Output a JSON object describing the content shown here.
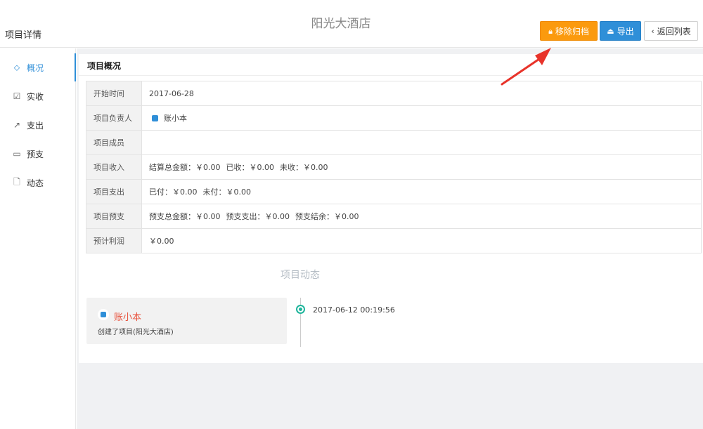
{
  "header": {
    "page_label": "项目详情",
    "hotel_title": "阳光大酒店",
    "buttons": {
      "archive": "移除归档",
      "export": "导出",
      "back": "返回列表"
    }
  },
  "sidebar": {
    "items": [
      {
        "label": "概况",
        "icon": "layers-icon",
        "active": true
      },
      {
        "label": "实收",
        "icon": "checkbox-icon",
        "active": false
      },
      {
        "label": "支出",
        "icon": "external-link-icon",
        "active": false
      },
      {
        "label": "预支",
        "icon": "folder-icon",
        "active": false
      },
      {
        "label": "动态",
        "icon": "file-icon",
        "active": false
      }
    ]
  },
  "overview": {
    "title": "项目概况",
    "rows": {
      "start_date": {
        "key": "开始时间",
        "value": "2017-06-28"
      },
      "owner": {
        "key": "项目负责人",
        "value": "账小本"
      },
      "members": {
        "key": "项目成员",
        "value": ""
      },
      "income": {
        "key": "项目收入",
        "settled_total": "结算总金额：￥0.00",
        "received": "已收：￥0.00",
        "unreceived": "未收：￥0.00"
      },
      "expense": {
        "key": "项目支出",
        "paid": "已付：￥0.00",
        "unpaid": "未付：￥0.00"
      },
      "advance": {
        "key": "项目预支",
        "advance_total": "预支总金额：￥0.00",
        "advance_spent": "预支支出：￥0.00",
        "advance_balance": "预支结余：￥0.00"
      },
      "profit": {
        "key": "预计利润",
        "value": "￥0.00"
      }
    }
  },
  "activity": {
    "title": "项目动态",
    "entries": [
      {
        "user": "账小本",
        "text": "创建了项目(阳光大酒店)",
        "time": "2017-06-12 00:19:56"
      }
    ]
  },
  "colors": {
    "primary": "#2f8fd8",
    "archive": "#fb9a0e",
    "user_name": "#e8533e",
    "timeline": "#1fb59c",
    "annotation_arrow": "#e8332a"
  }
}
